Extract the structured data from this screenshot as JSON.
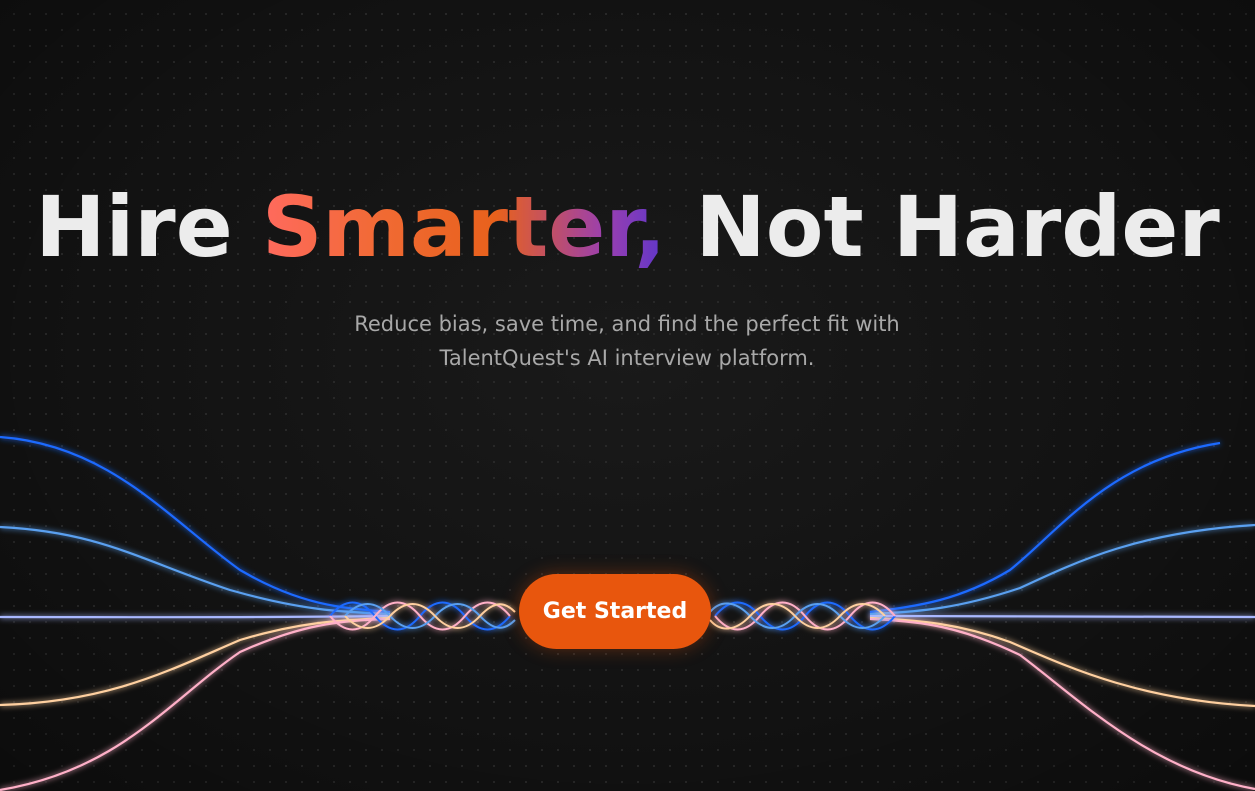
{
  "hero": {
    "headline_lead": "Hire ",
    "headline_highlight": "Smarter,",
    "headline_tail": " Not Harder",
    "subtitle_line1": "Reduce bias, save time, and find the perfect fit with",
    "subtitle_line2": "TalentQuest's AI interview platform.",
    "cta_label": "Get Started"
  },
  "colors": {
    "background": "#121212",
    "headline": "#ececec",
    "highlight_start": "#ff6a5e",
    "highlight_mid": "#e8611c",
    "highlight_end": "#5d36c9",
    "subtitle": "#a8a8a8",
    "cta": "#e8560d",
    "wave_blue": "#1e6bff",
    "wave_light_blue": "#5aa0f0",
    "wave_periwinkle": "#a9b8ff",
    "wave_peach": "#ffd0a0",
    "wave_pink": "#ffb0c8"
  }
}
